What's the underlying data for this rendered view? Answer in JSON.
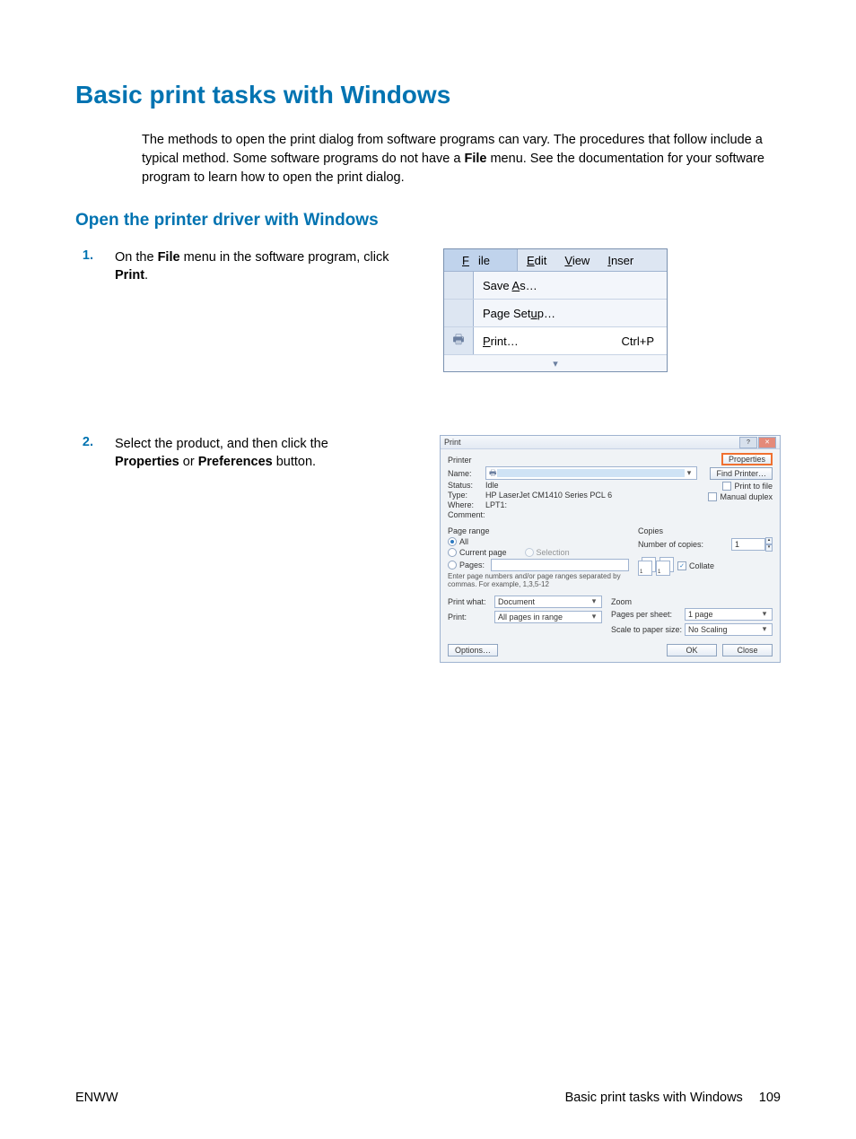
{
  "title": "Basic print tasks with Windows",
  "intro_pre": "The methods to open the print dialog from software programs can vary. The procedures that follow include a typical method. Some software programs do not have a ",
  "intro_bold1": "File",
  "intro_post": " menu. See the documentation for your software program to learn how to open the print dialog.",
  "subtitle": "Open the printer driver with Windows",
  "step1": {
    "num": "1.",
    "t1": "On the ",
    "b1": "File",
    "t2": " menu in the software program, click ",
    "b2": "Print",
    "t3": "."
  },
  "step2": {
    "num": "2.",
    "t1": "Select the product, and then click the ",
    "b1": "Properties",
    "t2": " or ",
    "b2": "Preferences",
    "t3": " button."
  },
  "menu": {
    "bar": {
      "file": "File",
      "edit": "Edit",
      "view": "View",
      "insert": "Inser"
    },
    "items": {
      "saveas": "Save As…",
      "pagesetup": "Page Setup…",
      "print": "Print…",
      "print_shortcut": "Ctrl+P"
    }
  },
  "dialog": {
    "title": "Print",
    "printer_section": "Printer",
    "name_lbl": "Name:",
    "properties_btn": "Properties",
    "findprinter_btn": "Find Printer…",
    "printtofile": "Print to file",
    "manualduplex": "Manual duplex",
    "status_lbl": "Status:",
    "status_val": "Idle",
    "type_lbl": "Type:",
    "type_val": "HP LaserJet CM1410 Series PCL 6",
    "where_lbl": "Where:",
    "where_val": "LPT1:",
    "comment_lbl": "Comment:",
    "pagerange_section": "Page range",
    "all": "All",
    "currentpage": "Current page",
    "selection": "Selection",
    "pages": "Pages:",
    "hint": "Enter page numbers and/or page ranges separated by commas.  For example, 1,3,5-12",
    "copies_section": "Copies",
    "numcopies_lbl": "Number of copies:",
    "numcopies_val": "1",
    "collate": "Collate",
    "printwhat_lbl": "Print what:",
    "printwhat_val": "Document",
    "print_lbl": "Print:",
    "print_val": "All pages in range",
    "zoom_section": "Zoom",
    "pps_lbl": "Pages per sheet:",
    "pps_val": "1 page",
    "sps_lbl": "Scale to paper size:",
    "sps_val": "No Scaling",
    "options_btn": "Options…",
    "ok_btn": "OK",
    "close_btn": "Close"
  },
  "footer": {
    "left": "ENWW",
    "right_text": "Basic print tasks with Windows",
    "page_num": "109"
  }
}
